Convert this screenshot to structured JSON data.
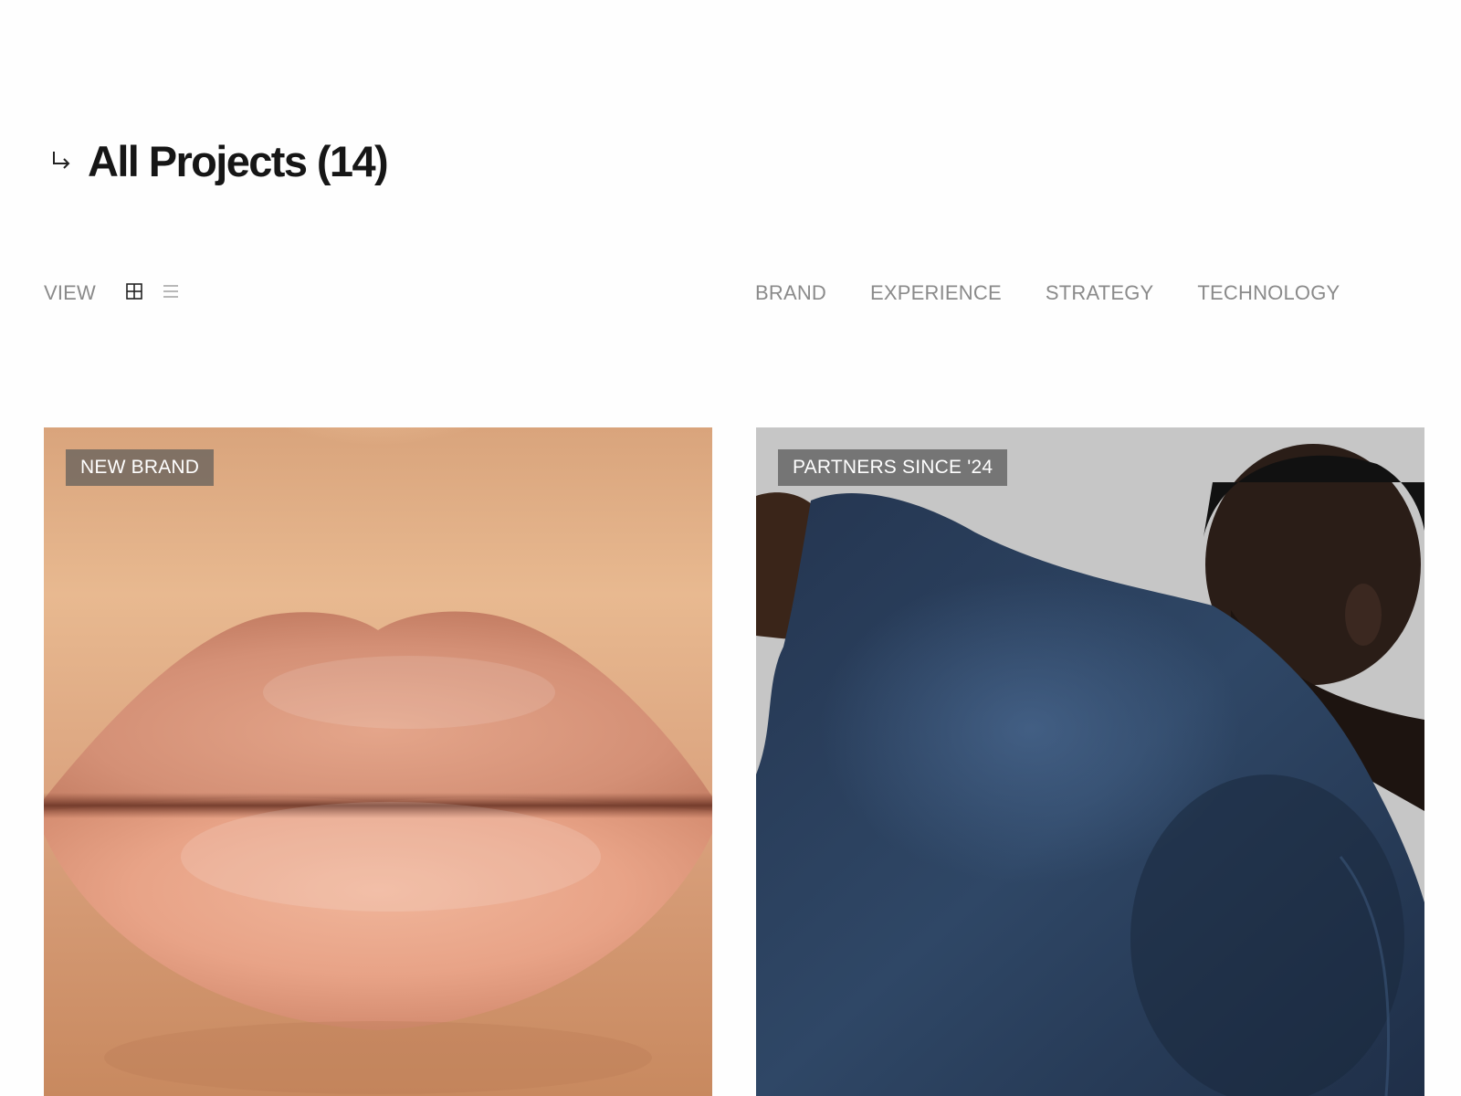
{
  "header": {
    "arrow_icon": "return-arrow-icon",
    "title": "All Projects (14)"
  },
  "toolbar": {
    "view_label": "VIEW",
    "grid_icon": "grid-view-icon",
    "list_icon": "list-view-icon",
    "filters": [
      "BRAND",
      "EXPERIENCE",
      "STRATEGY",
      "TECHNOLOGY"
    ]
  },
  "projects": [
    {
      "badge": "NEW BRAND",
      "image": "lips-closeup-photo"
    },
    {
      "badge": "PARTNERS SINCE '24",
      "image": "man-in-navy-tshirt-photo"
    }
  ],
  "colors": {
    "title": "#161616",
    "toolbar_text": "#8a8a8a",
    "badge_left_bg": "#786c62",
    "badge_right_bg": "#6e6e6e",
    "right_card_bg": "#c6c6c6",
    "shirt": "#2c3e58"
  }
}
